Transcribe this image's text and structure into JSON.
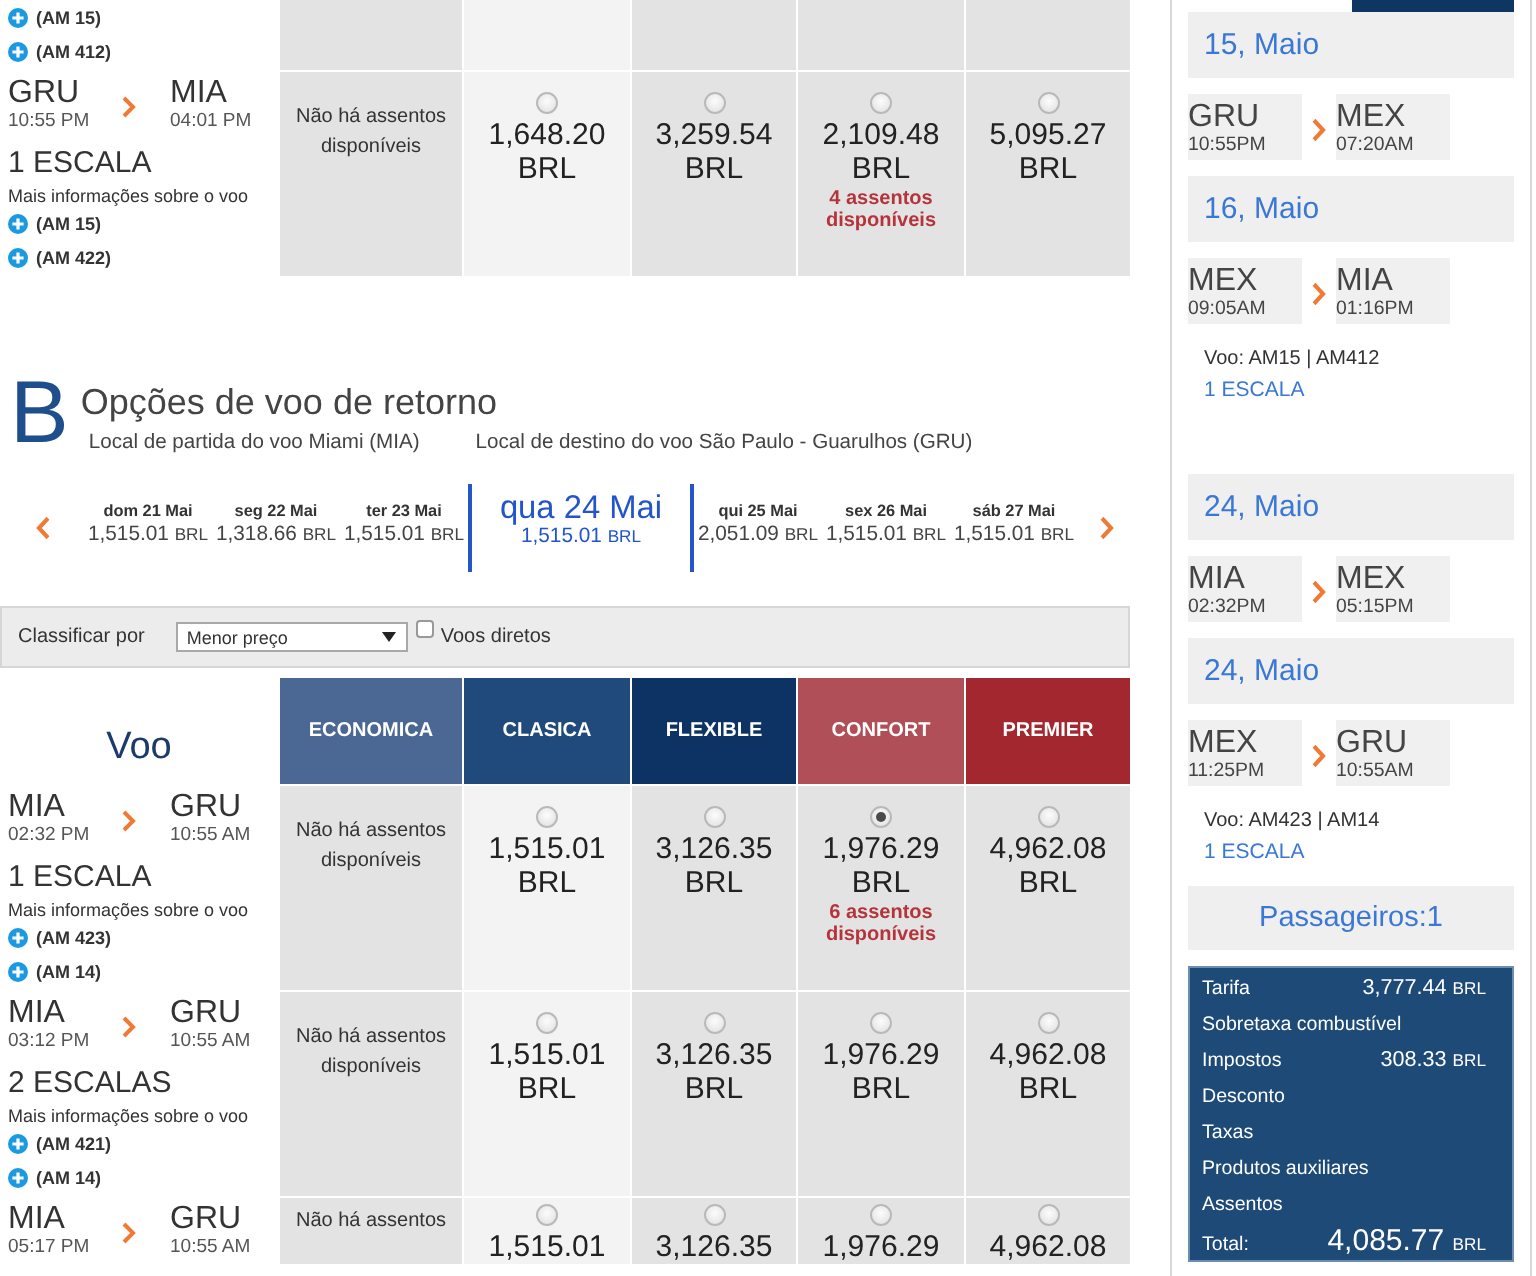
{
  "outbound": {
    "columns": [
      {
        "highlighted": false
      },
      {
        "highlighted": true
      },
      {
        "highlighted": false
      },
      {
        "highlighted": false
      },
      {
        "highlighted": false
      }
    ],
    "rows": [
      {
        "flights": [
          "(AM 15)",
          "(AM 412)"
        ]
      },
      {
        "origin": {
          "code": "GRU",
          "time": "10:55 PM"
        },
        "destination": {
          "code": "MIA",
          "time": "04:01 PM"
        },
        "stops": "1 ESCALA",
        "info_link": "Mais informações sobre o voo",
        "flights": [
          "(AM 15)",
          "(AM 422)"
        ],
        "fares": [
          {
            "kind": "unavailable",
            "text": "Não há assentos disponíveis"
          },
          {
            "kind": "price",
            "price": "1,648.20",
            "currency": "BRL",
            "selected": false
          },
          {
            "kind": "price",
            "price": "3,259.54",
            "currency": "BRL",
            "selected": false
          },
          {
            "kind": "price",
            "price": "2,109.48",
            "currency": "BRL",
            "seats": "4 assentos disponíveis",
            "selected": false
          },
          {
            "kind": "price",
            "price": "5,095.27",
            "currency": "BRL",
            "selected": false
          }
        ]
      }
    ]
  },
  "return": {
    "letter": "B",
    "title": "Opções de voo de retorno",
    "departure": "Local de partida do voo Miami (MIA)",
    "destination": "Local de destino do voo São Paulo - Guarulhos (GRU)",
    "dates": [
      {
        "day": "dom 21 Mai",
        "price": "1,515.01",
        "currency": "BRL",
        "selected": false
      },
      {
        "day": "seg 22 Mai",
        "price": "1,318.66",
        "currency": "BRL",
        "selected": false
      },
      {
        "day": "ter 23 Mai",
        "price": "1,515.01",
        "currency": "BRL",
        "selected": false
      },
      {
        "day": "qua 24 Mai",
        "price": "1,515.01",
        "currency": "BRL",
        "selected": true
      },
      {
        "day": "qui 25 Mai",
        "price": "2,051.09",
        "currency": "BRL",
        "selected": false
      },
      {
        "day": "sex 26 Mai",
        "price": "1,515.01",
        "currency": "BRL",
        "selected": false
      },
      {
        "day": "sáb 27 Mai",
        "price": "1,515.01",
        "currency": "BRL",
        "selected": false
      }
    ],
    "sort": {
      "label": "Classificar por",
      "value": "Menor preço",
      "direct": {
        "label": "Voos diretos",
        "checked": false
      }
    },
    "table": {
      "title": "Voo",
      "columns": [
        {
          "label": "ECONOMICA",
          "color": "#4a6893",
          "highlighted": false
        },
        {
          "label": "CLASICA",
          "color": "#1f4a7b",
          "highlighted": true
        },
        {
          "label": "FLEXIBLE",
          "color": "#0d3264",
          "highlighted": false
        },
        {
          "label": "CONFORT",
          "color": "#b04f58",
          "highlighted": false
        },
        {
          "label": "PREMIER",
          "color": "#a3272f",
          "highlighted": false
        }
      ],
      "rows": [
        {
          "origin": {
            "code": "MIA",
            "time": "02:32 PM"
          },
          "destination": {
            "code": "GRU",
            "time": "10:55 AM"
          },
          "stops": "1 ESCALA",
          "info_link": "Mais informações sobre o voo",
          "flights": [
            "(AM 423)",
            "(AM 14)"
          ],
          "fares": [
            {
              "kind": "unavailable",
              "text": "Não há assentos disponíveis"
            },
            {
              "kind": "price",
              "price": "1,515.01",
              "currency": "BRL",
              "selected": false
            },
            {
              "kind": "price",
              "price": "3,126.35",
              "currency": "BRL",
              "selected": false
            },
            {
              "kind": "price",
              "price": "1,976.29",
              "currency": "BRL",
              "seats": "6 assentos disponíveis",
              "selected": true
            },
            {
              "kind": "price",
              "price": "4,962.08",
              "currency": "BRL",
              "selected": false
            }
          ]
        },
        {
          "origin": {
            "code": "MIA",
            "time": "03:12 PM"
          },
          "destination": {
            "code": "GRU",
            "time": "10:55 AM"
          },
          "stops": "2 ESCALAS",
          "info_link": "Mais informações sobre o voo",
          "flights": [
            "(AM 421)",
            "(AM 14)"
          ],
          "fares": [
            {
              "kind": "unavailable",
              "text": "Não há assentos disponíveis"
            },
            {
              "kind": "price",
              "price": "1,515.01",
              "currency": "BRL",
              "selected": false
            },
            {
              "kind": "price",
              "price": "3,126.35",
              "currency": "BRL",
              "selected": false
            },
            {
              "kind": "price",
              "price": "1,976.29",
              "currency": "BRL",
              "selected": false
            },
            {
              "kind": "price",
              "price": "4,962.08",
              "currency": "BRL",
              "selected": false
            }
          ]
        },
        {
          "origin": {
            "code": "MIA",
            "time": "05:17 PM"
          },
          "destination": {
            "code": "GRU",
            "time": "10:55 AM"
          },
          "fares": [
            {
              "kind": "unavailable",
              "text": "Não há assentos"
            },
            {
              "kind": "price",
              "price": "1,515.01",
              "selected": false
            },
            {
              "kind": "price",
              "price": "3,126.35",
              "selected": false
            },
            {
              "kind": "price",
              "price": "1,976.29",
              "selected": false
            },
            {
              "kind": "price",
              "price": "4,962.08",
              "selected": false
            }
          ]
        }
      ]
    }
  },
  "summary": {
    "trips": [
      {
        "legs": [
          {
            "date": "15, Maio",
            "from": {
              "code": "GRU",
              "time": "10:55PM"
            },
            "to": {
              "code": "MEX",
              "time": "07:20AM"
            }
          },
          {
            "date": "16, Maio",
            "from": {
              "code": "MEX",
              "time": "09:05AM"
            },
            "to": {
              "code": "MIA",
              "time": "01:16PM"
            }
          }
        ],
        "flights": "Voo: AM15 | AM412",
        "stops": "1 ESCALA"
      },
      {
        "legs": [
          {
            "date": "24, Maio",
            "from": {
              "code": "MIA",
              "time": "02:32PM"
            },
            "to": {
              "code": "MEX",
              "time": "05:15PM"
            }
          },
          {
            "date": "24, Maio",
            "from": {
              "code": "MEX",
              "time": "11:25PM"
            },
            "to": {
              "code": "GRU",
              "time": "10:55AM"
            }
          }
        ],
        "flights": "Voo: AM423 | AM14",
        "stops": "1 ESCALA"
      }
    ],
    "passengers": "Passageiros:1",
    "charges": [
      {
        "label": "Tarifa",
        "amount": "3,777.44",
        "currency": "BRL"
      },
      {
        "label": "Sobretaxa combustível"
      },
      {
        "label": "Impostos",
        "amount": "308.33",
        "currency": "BRL"
      },
      {
        "label": "Desconto"
      },
      {
        "label": "Taxas"
      },
      {
        "label": "Produtos auxiliares"
      },
      {
        "label": "Assentos"
      }
    ],
    "total": {
      "label": "Total:",
      "amount": "4,085.77",
      "currency": "BRL"
    }
  }
}
